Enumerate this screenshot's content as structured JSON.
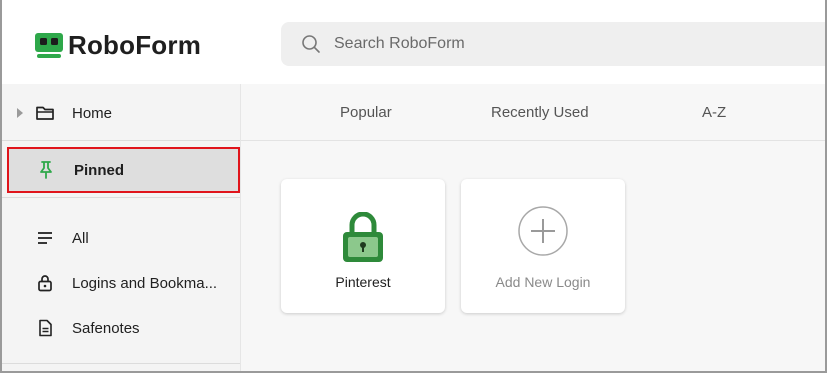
{
  "header": {
    "logo_text": "RoboForm",
    "search": {
      "placeholder": "Search RoboForm"
    }
  },
  "sidebar": {
    "items": [
      {
        "label": "Home",
        "icon": "folder-icon"
      },
      {
        "label": "Pinned",
        "icon": "pin-icon",
        "selected": true
      },
      {
        "label": "All",
        "icon": "list-icon"
      },
      {
        "label": "Logins and Bookma...",
        "icon": "lock-icon"
      },
      {
        "label": "Safenotes",
        "icon": "note-icon"
      }
    ]
  },
  "main": {
    "tabs": [
      {
        "label": "Popular"
      },
      {
        "label": "Recently Used"
      },
      {
        "label": "A-Z"
      }
    ],
    "cards": [
      {
        "label": "Pinterest",
        "icon": "green-lock-icon"
      },
      {
        "label": "Add New Login",
        "icon": "add-circle-icon"
      }
    ]
  },
  "colors": {
    "brand_green": "#2ea84a",
    "highlight_red": "#e0141b"
  }
}
